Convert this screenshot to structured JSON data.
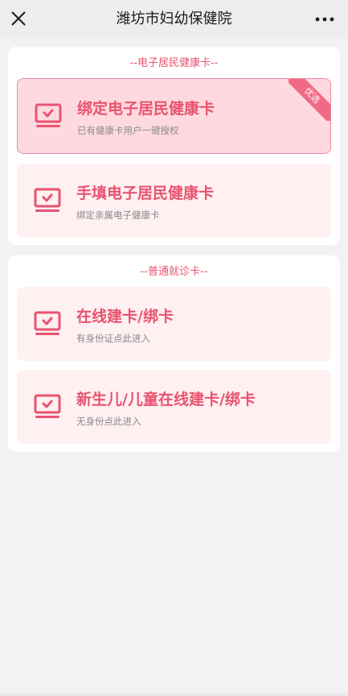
{
  "header": {
    "title": "潍坊市妇幼保健院",
    "close_icon": "close-icon",
    "more_icon": "more-icon"
  },
  "sections": [
    {
      "title": "--电子居民健康卡--",
      "cards": [
        {
          "title": "绑定电子居民健康卡",
          "subtitle": "已有健康卡用户一键授权",
          "badge": "优选",
          "icon": "card-icon"
        },
        {
          "title": "手填电子居民健康卡",
          "subtitle": "绑定亲属电子健康卡",
          "icon": "card-icon"
        }
      ]
    },
    {
      "title": "--普通就诊卡--",
      "cards": [
        {
          "title": "在线建卡/绑卡",
          "subtitle": "有身份证点此进入",
          "icon": "card-icon"
        },
        {
          "title": "新生儿/儿童在线建卡/绑卡",
          "subtitle": "无身份点此进入",
          "icon": "card-icon"
        }
      ]
    }
  ],
  "colors": {
    "accent": "#e8536f",
    "card_bg": "#fff0f2",
    "preferred_bg": "#ffd9e0",
    "badge_bg": "#f06a85"
  }
}
